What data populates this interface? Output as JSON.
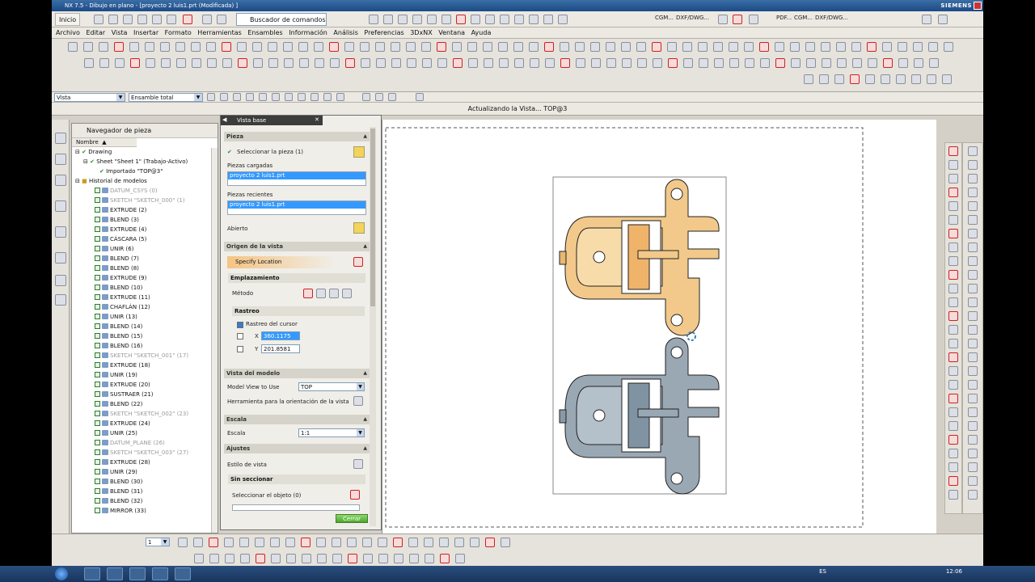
{
  "window": {
    "title": "NX 7.5 - Dibujo en plano - [proyecto 2 luis1.prt (Modificada) ]",
    "brand": "SIEMENS"
  },
  "standard_toolbar": {
    "start_label": "Inicio",
    "command_finder_label": "Buscador de comandos",
    "right_commands": [
      "CGM...",
      "DXF/DWG...",
      "PDF...",
      "CGM...",
      "DXF/DWG..."
    ]
  },
  "menu": {
    "items": [
      "Archivo",
      "Editar",
      "Vista",
      "Insertar",
      "Formato",
      "Herramientas",
      "Ensambles",
      "Información",
      "Análisis",
      "Preferencias",
      "3DxNX",
      "Ventana",
      "Ayuda"
    ]
  },
  "selection_bar": {
    "filter_value": "Vista",
    "scope_value": "Ensamble total"
  },
  "status": {
    "message": "Actualizando la Vista... TOP@3"
  },
  "navigator": {
    "title": "Navegador de pieza",
    "column_header": "Nombre",
    "drawing_nodes": [
      {
        "label": "Drawing"
      },
      {
        "label": "Sheet \"Sheet 1\" (Trabajo-Activo)"
      },
      {
        "label": "Importado \"TOP@3\""
      }
    ],
    "history_header": "Historial de modelos",
    "features": [
      {
        "label": "DATUM_CSYS (0)",
        "dim": true
      },
      {
        "label": "SKETCH \"SKETCH_000\" (1)",
        "dim": true
      },
      {
        "label": "EXTRUDE (2)",
        "dim": false
      },
      {
        "label": "BLEND (3)",
        "dim": false
      },
      {
        "label": "EXTRUDE (4)",
        "dim": false
      },
      {
        "label": "CÁSCARA (5)",
        "dim": false
      },
      {
        "label": "UNIR (6)",
        "dim": false
      },
      {
        "label": "BLEND (7)",
        "dim": false
      },
      {
        "label": "BLEND (8)",
        "dim": false
      },
      {
        "label": "EXTRUDE (9)",
        "dim": false
      },
      {
        "label": "BLEND (10)",
        "dim": false
      },
      {
        "label": "EXTRUDE (11)",
        "dim": false
      },
      {
        "label": "CHAFLÁN (12)",
        "dim": false
      },
      {
        "label": "UNIR (13)",
        "dim": false
      },
      {
        "label": "BLEND (14)",
        "dim": false
      },
      {
        "label": "BLEND (15)",
        "dim": false
      },
      {
        "label": "BLEND (16)",
        "dim": false
      },
      {
        "label": "SKETCH \"SKETCH_001\" (17)",
        "dim": true
      },
      {
        "label": "EXTRUDE (18)",
        "dim": false
      },
      {
        "label": "UNIR (19)",
        "dim": false
      },
      {
        "label": "EXTRUDE (20)",
        "dim": false
      },
      {
        "label": "SUSTRAER (21)",
        "dim": false
      },
      {
        "label": "BLEND (22)",
        "dim": false
      },
      {
        "label": "SKETCH \"SKETCH_002\" (23)",
        "dim": true
      },
      {
        "label": "EXTRUDE (24)",
        "dim": false
      },
      {
        "label": "UNIR (25)",
        "dim": false
      },
      {
        "label": "DATUM_PLANE (26)",
        "dim": true
      },
      {
        "label": "SKETCH \"SKETCH_003\" (27)",
        "dim": true
      },
      {
        "label": "EXTRUDE (28)",
        "dim": false
      },
      {
        "label": "UNIR (29)",
        "dim": false
      },
      {
        "label": "BLEND (30)",
        "dim": false
      },
      {
        "label": "BLEND (31)",
        "dim": false
      },
      {
        "label": "BLEND (32)",
        "dim": false
      },
      {
        "label": "MIRROR (33)",
        "dim": false
      }
    ]
  },
  "dialog": {
    "title": "Vista base",
    "section_part": "Pieza",
    "select_part": "Seleccionar la pieza (1)",
    "loaded_parts_label": "Piezas cargadas",
    "loaded_part": "proyecto 2 luis1.prt",
    "recent_parts_label": "Piezas recientes",
    "recent_part": "proyecto 2 luis1.prt",
    "open_label": "Abierto",
    "section_origin": "Origen de la vista",
    "specify_location": "Specify Location",
    "section_placement": "Emplazamiento",
    "method_label": "Método",
    "section_tracking": "Rastreo",
    "cursor_tracking": "Rastreo del cursor",
    "x_label": "X",
    "x_value": "360.1175",
    "y_label": "Y",
    "y_value": "201.8581",
    "section_model_view": "Vista del modelo",
    "model_view_label": "Model View to Use",
    "model_view_value": "TOP",
    "orientation_tool_label": "Herramienta para la orientación de la vista",
    "section_scale": "Escala",
    "scale_label": "Escala",
    "scale_value": "1:1",
    "section_settings": "Ajustes",
    "view_style_label": "Estilo de vista",
    "section_no_section": "Sin seccionar",
    "select_object": "Seleccionar el objeto (0)",
    "close_button": "Cerrar"
  },
  "bottom_toolbar": {
    "page_value": "1"
  },
  "taskbar": {
    "lang": "ES",
    "clock": "12:06"
  },
  "colors": {
    "part_shaded_preview": "#f2c98a",
    "part_shaded_final": "#9aa8b4",
    "dialog_title_bg": "#3c3c3c",
    "selection_blue": "#3399ff"
  }
}
